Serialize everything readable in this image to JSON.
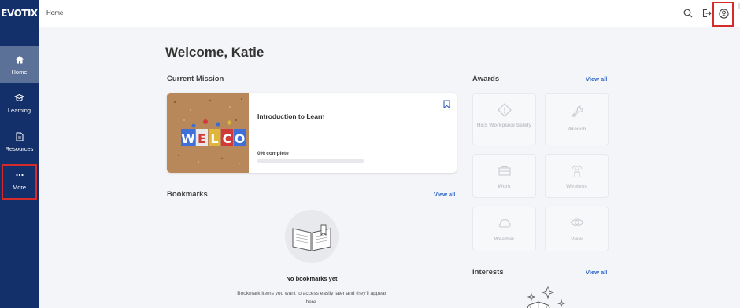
{
  "brand": {
    "logo_text": "EVOTIX"
  },
  "sidebar": {
    "items": [
      {
        "label": "Home",
        "icon": "home-icon",
        "active": true
      },
      {
        "label": "Learning",
        "icon": "graduation-cap-icon",
        "active": false
      },
      {
        "label": "Resources",
        "icon": "document-icon",
        "active": false
      },
      {
        "label": "More",
        "icon": "more-dots-icon",
        "active": false
      }
    ]
  },
  "topbar": {
    "breadcrumb": "Home",
    "icons": [
      "search-icon",
      "logout-icon",
      "user-account-icon"
    ]
  },
  "main": {
    "welcome": "Welcome, Katie",
    "current_mission": {
      "section_title": "Current Mission",
      "course_title": "Introduction to Learn",
      "image_text": "WELCO",
      "progress_label": "0% complete",
      "progress": 0
    },
    "bookmarks": {
      "section_title": "Bookmarks",
      "view_all": "View all",
      "empty_title": "No bookmarks yet",
      "empty_desc": "Bookmark items you want to access easily later and they'll appear here."
    },
    "awards": {
      "section_title": "Awards",
      "view_all": "View all",
      "items": [
        {
          "label": "H&S Workplace Safety",
          "icon": "warning-diamond-icon"
        },
        {
          "label": "Wrench",
          "icon": "wrench-icon"
        },
        {
          "label": "Work",
          "icon": "work-icon"
        },
        {
          "label": "Wireless",
          "icon": "wireless-icon"
        },
        {
          "label": "Weather",
          "icon": "weather-icon"
        },
        {
          "label": "View",
          "icon": "eye-icon"
        }
      ]
    },
    "interests": {
      "section_title": "Interests",
      "view_all": "View all"
    }
  },
  "colors": {
    "sidebar": "#13306b",
    "sidebar_active": "#5b7198",
    "accent": "#2e64c7",
    "highlight_box": "#d62b2b"
  }
}
